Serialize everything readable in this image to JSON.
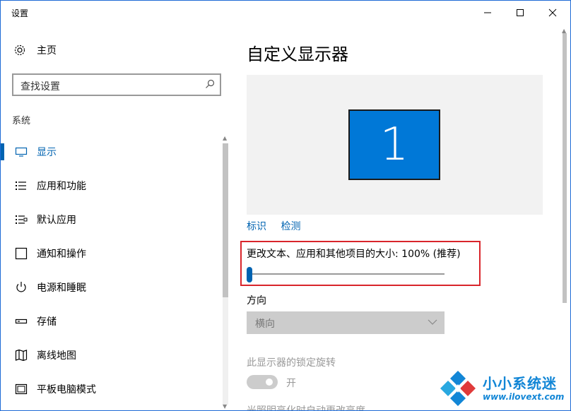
{
  "window": {
    "title": "设置",
    "controls": {
      "minimize": "—",
      "maximize": "☐",
      "close": "✕"
    }
  },
  "sidebar": {
    "home_label": "主页",
    "search_placeholder": "查找设置",
    "section_label": "系统",
    "items": [
      {
        "label": "显示",
        "icon": "monitor-icon",
        "active": true
      },
      {
        "label": "应用和功能",
        "icon": "apps-list-icon",
        "active": false
      },
      {
        "label": "默认应用",
        "icon": "default-apps-icon",
        "active": false
      },
      {
        "label": "通知和操作",
        "icon": "notification-icon",
        "active": false
      },
      {
        "label": "电源和睡眠",
        "icon": "power-icon",
        "active": false
      },
      {
        "label": "存储",
        "icon": "storage-icon",
        "active": false
      },
      {
        "label": "离线地图",
        "icon": "map-icon",
        "active": false
      },
      {
        "label": "平板电脑模式",
        "icon": "tablet-icon",
        "active": false
      }
    ]
  },
  "main": {
    "title": "自定义显示器",
    "monitor_number": "1",
    "links": {
      "identify": "标识",
      "detect": "检测"
    },
    "scale_label": "更改文本、应用和其他项目的大小: 100% (推荐)",
    "scale_slider_value": 0,
    "orientation_label": "方向",
    "orientation_value": "横向",
    "lock_rotation_label": "此显示器的锁定旋转",
    "lock_rotation_state": "开",
    "cut_label": "光照明亮化时自动更改亮度"
  },
  "watermark": {
    "brand": "小小系统迷",
    "url": "www.ilovext.com"
  },
  "colors": {
    "accent": "#0063b1",
    "monitor": "#0078d7",
    "highlight_box": "#d9252b",
    "watermark": "#1286d6"
  }
}
